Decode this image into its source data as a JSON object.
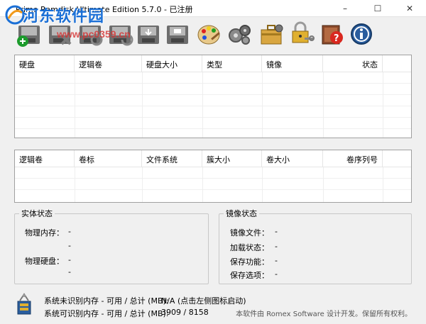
{
  "window": {
    "title": "Primo Ramdisk Ultimate Edition 5.7.0 - 已注册",
    "minimize": "–",
    "maximize": "☐",
    "close": "✕"
  },
  "watermark": {
    "name": "河东软件园",
    "url": "www.pc0359.cn"
  },
  "toolbar": {
    "buttons": [
      {
        "name": "create-disk-button",
        "icon": "disk-add-icon"
      },
      {
        "name": "remove-disk-button",
        "icon": "disk-remove-icon"
      },
      {
        "name": "edit-disk-button",
        "icon": "disk-edit-icon"
      },
      {
        "name": "refresh-disk-button",
        "icon": "disk-refresh-icon"
      },
      {
        "name": "load-image-button",
        "icon": "disk-load-icon"
      },
      {
        "name": "save-image-button",
        "icon": "disk-save-icon"
      },
      {
        "name": "options-button",
        "icon": "palette-icon"
      },
      {
        "name": "tools-button",
        "icon": "gears-icon"
      },
      {
        "name": "service-button",
        "icon": "toolbox-icon"
      },
      {
        "name": "register-button",
        "icon": "lock-key-icon"
      },
      {
        "name": "help-button",
        "icon": "help-book-icon"
      },
      {
        "name": "about-button",
        "icon": "info-icon"
      }
    ]
  },
  "disk_table": {
    "columns": [
      "硬盘",
      "逻辑卷",
      "硬盘大小",
      "类型",
      "镜像",
      "状态"
    ]
  },
  "volume_table": {
    "columns": [
      "逻辑卷",
      "卷标",
      "文件系统",
      "簇大小",
      "卷大小",
      "卷序列号"
    ]
  },
  "entity_status": {
    "legend": "实体状态",
    "physical_memory_label": "物理内存：",
    "physical_memory_value_1": "-",
    "physical_memory_value_2": "-",
    "physical_disk_label": "物理硬盘：",
    "physical_disk_value_1": "-",
    "physical_disk_value_2": "-"
  },
  "image_status": {
    "legend": "镜像状态",
    "image_file_label": "镜像文件：",
    "image_file_value": "-",
    "load_status_label": "加载状态：",
    "load_status_value": "-",
    "save_function_label": "保存功能：",
    "save_function_value": "-",
    "save_options_label": "保存选项：",
    "save_options_value": "-"
  },
  "status_bar": {
    "unrecognized_label": "系统未识别内存 - 可用 / 总计 (MB):",
    "unrecognized_value": "N/A (点击左侧图标启动)",
    "recognized_label": "系统可识别内存 - 可用 / 总计 (MB):",
    "recognized_value": "3909 / 8158",
    "copyright": "本软件由 Romex Software 设计开发。保留所有权利。"
  }
}
